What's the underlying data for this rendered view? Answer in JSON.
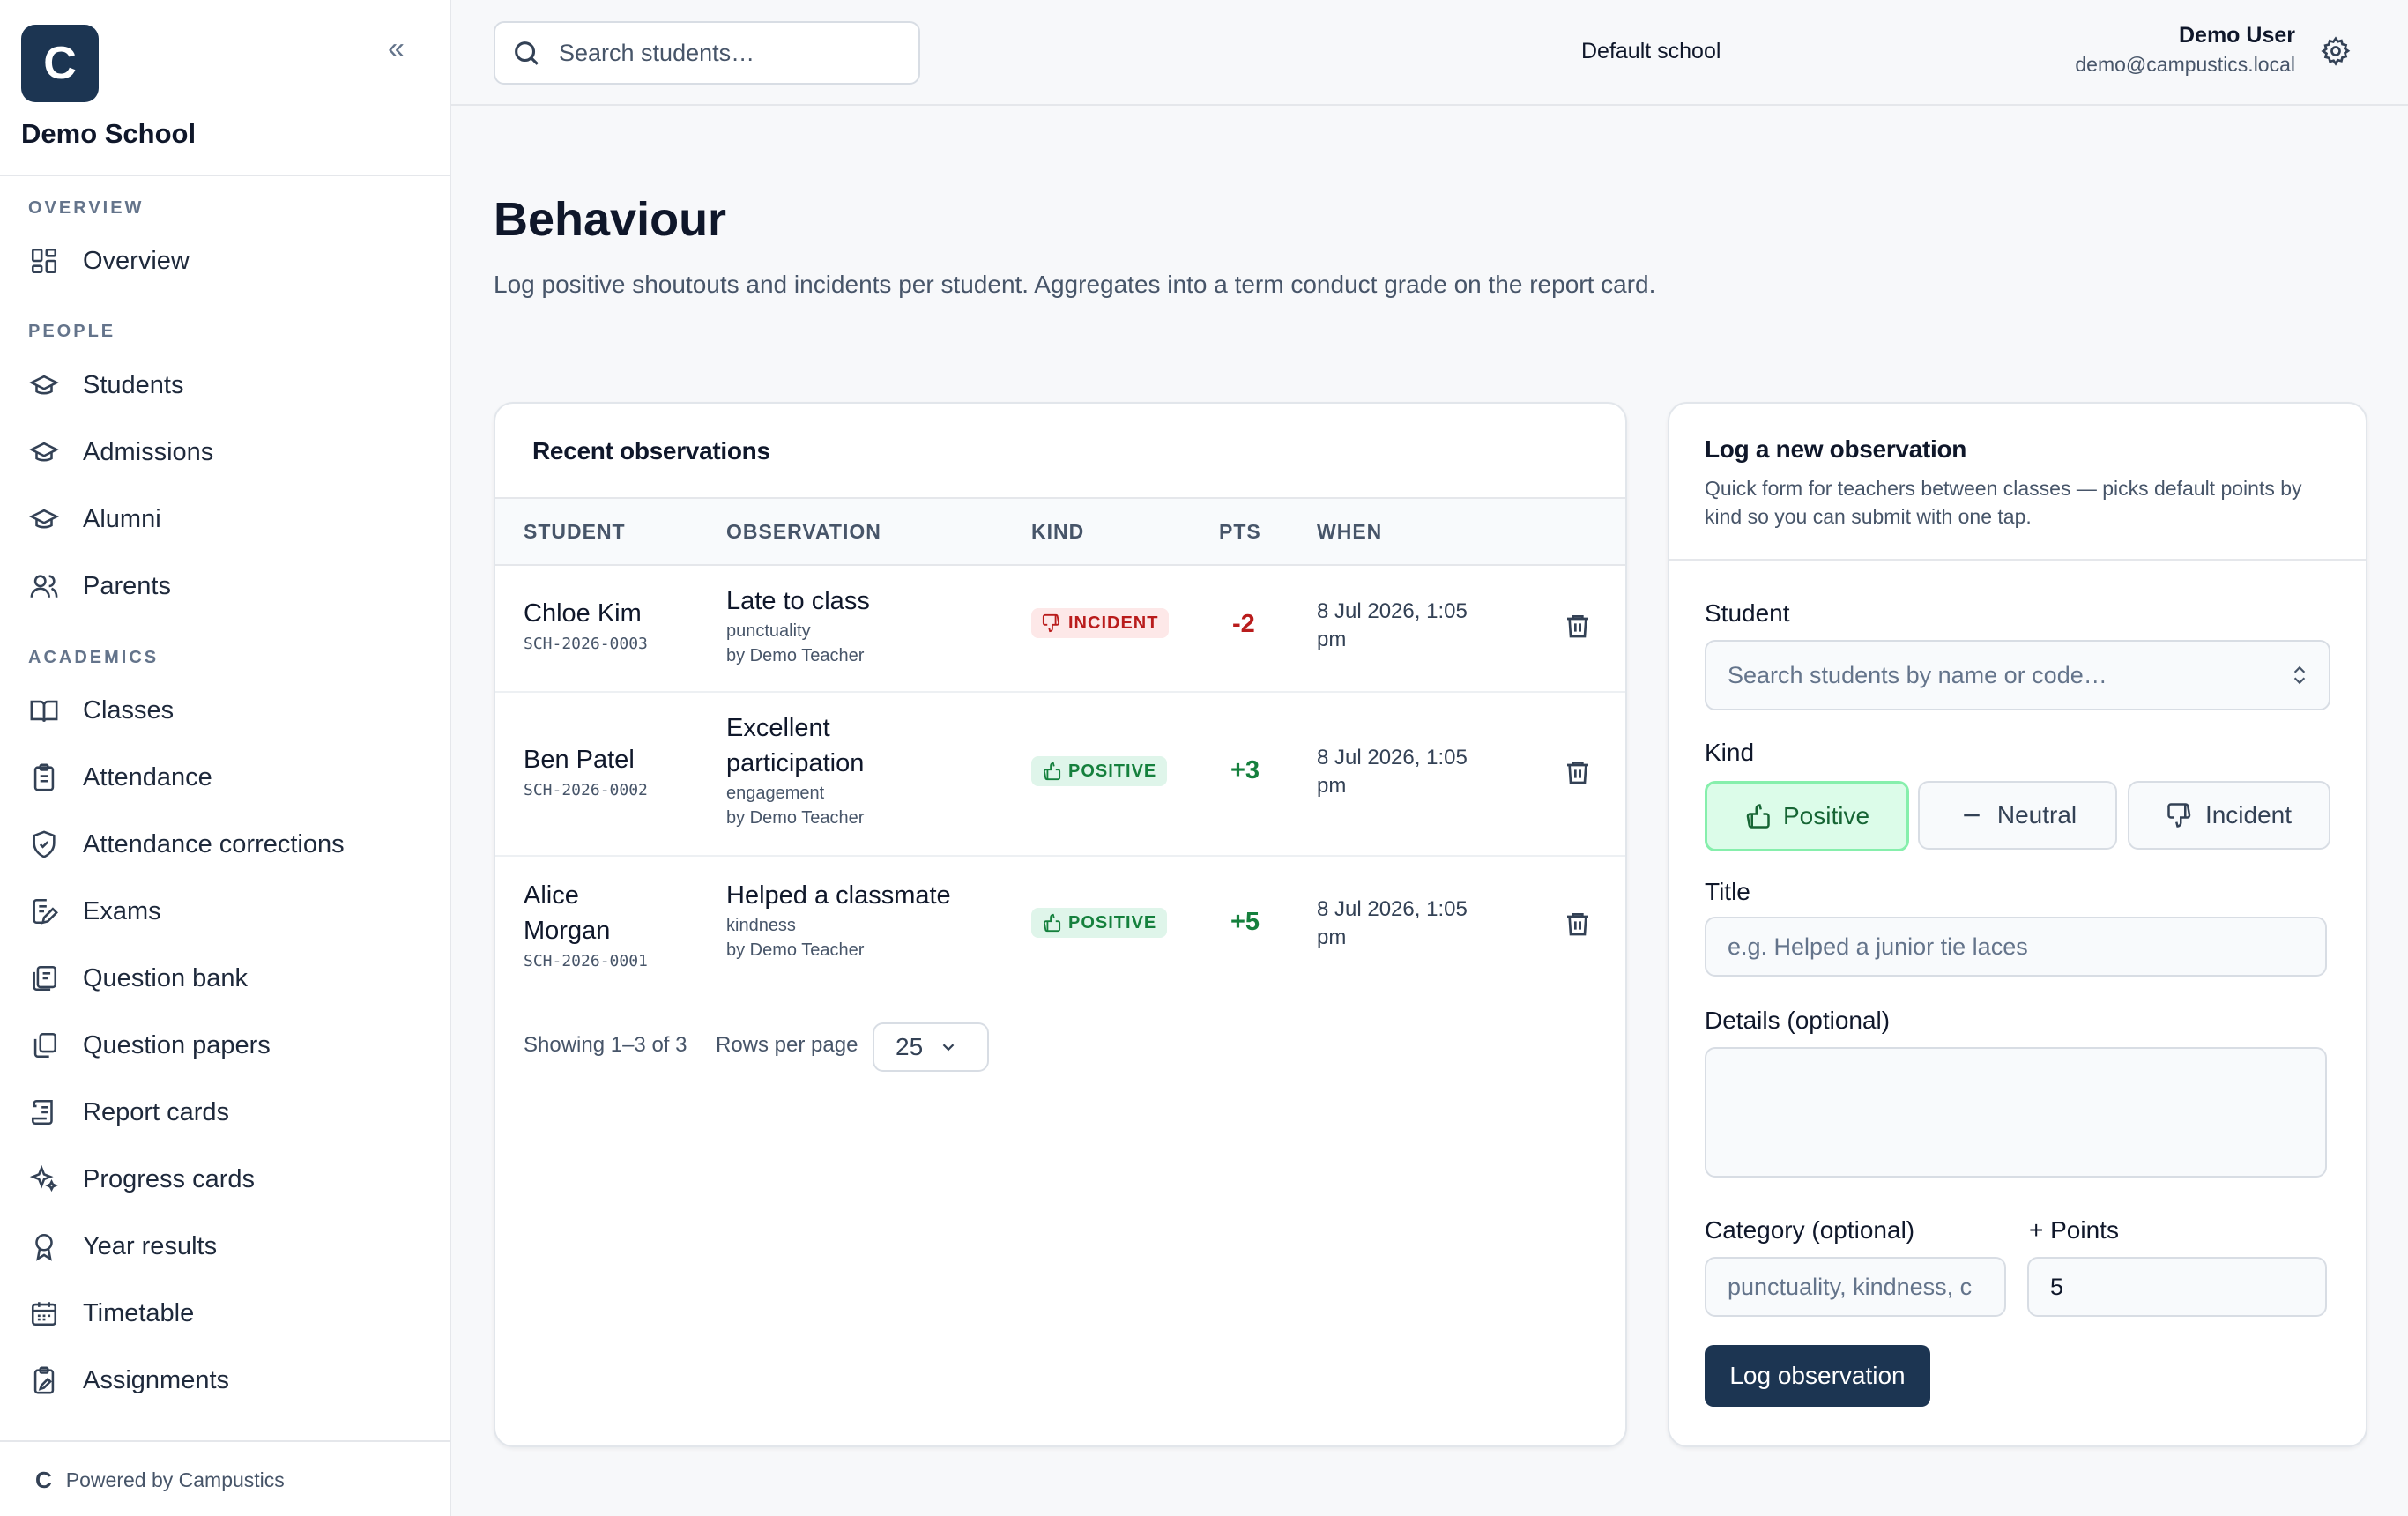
{
  "sidebar": {
    "logo_letter": "C",
    "collapse_icon": "«",
    "school_name": "Demo School",
    "sections": {
      "overview": "OVERVIEW",
      "people": "PEOPLE",
      "academics": "ACADEMICS"
    },
    "items": {
      "overview": "Overview",
      "students": "Students",
      "admissions": "Admissions",
      "alumni": "Alumni",
      "parents": "Parents",
      "classes": "Classes",
      "attendance": "Attendance",
      "attendance_corrections": "Attendance corrections",
      "exams": "Exams",
      "question_bank": "Question bank",
      "question_papers": "Question papers",
      "report_cards": "Report cards",
      "progress_cards": "Progress cards",
      "year_results": "Year results",
      "timetable": "Timetable",
      "assignments": "Assignments"
    },
    "footer": {
      "mark": "C",
      "text": "Powered by Campustics"
    }
  },
  "topbar": {
    "search_placeholder": "Search students…",
    "school_switch": "Default school",
    "user_name": "Demo User",
    "user_email": "demo@campustics.local"
  },
  "page": {
    "title": "Behaviour",
    "description": "Log positive shoutouts and incidents per student. Aggregates into a term conduct grade on the report card."
  },
  "observations": {
    "title": "Recent observations",
    "columns": {
      "student": "STUDENT",
      "observation": "OBSERVATION",
      "kind": "KIND",
      "pts": "PTS",
      "when": "WHEN"
    },
    "rows": [
      {
        "student": "Chloe Kim",
        "code": "SCH-2026-0003",
        "title": "Late to class",
        "category": "punctuality",
        "by": "by Demo Teacher",
        "kind": "INCIDENT",
        "pts": "-2",
        "when": "8 Jul 2026, 1:05 pm"
      },
      {
        "student": "Ben Patel",
        "code": "SCH-2026-0002",
        "title": "Excellent participation",
        "category": "engagement",
        "by": "by Demo Teacher",
        "kind": "POSITIVE",
        "pts": "+3",
        "when": "8 Jul 2026, 1:05 pm"
      },
      {
        "student": "Alice Morgan",
        "code": "SCH-2026-0001",
        "title": "Helped a classmate",
        "category": "kindness",
        "by": "by Demo Teacher",
        "kind": "POSITIVE",
        "pts": "+5",
        "when": "8 Jul 2026, 1:05 pm"
      }
    ],
    "pager": {
      "info": "Showing 1–3 of 3",
      "rows_label": "Rows per page",
      "rows_value": "25"
    }
  },
  "form": {
    "title": "Log a new observation",
    "description": "Quick form for teachers between classes — picks default points by kind so you can submit with one tap.",
    "student_label": "Student",
    "student_placeholder": "Search students by name or code…",
    "kind_label": "Kind",
    "kinds": {
      "positive": "Positive",
      "neutral": "Neutral",
      "incident": "Incident"
    },
    "selected_kind": "Positive",
    "title_label": "Title",
    "title_placeholder": "e.g. Helped a junior tie laces",
    "details_label": "Details (optional)",
    "category_label": "Category (optional)",
    "category_placeholder": "punctuality, kindness, c",
    "points_label": "+ Points",
    "points_value": "5",
    "submit_label": "Log observation"
  },
  "colors": {
    "brand": "#1c3552",
    "positive": "#15803d",
    "incident": "#b91c1c"
  }
}
